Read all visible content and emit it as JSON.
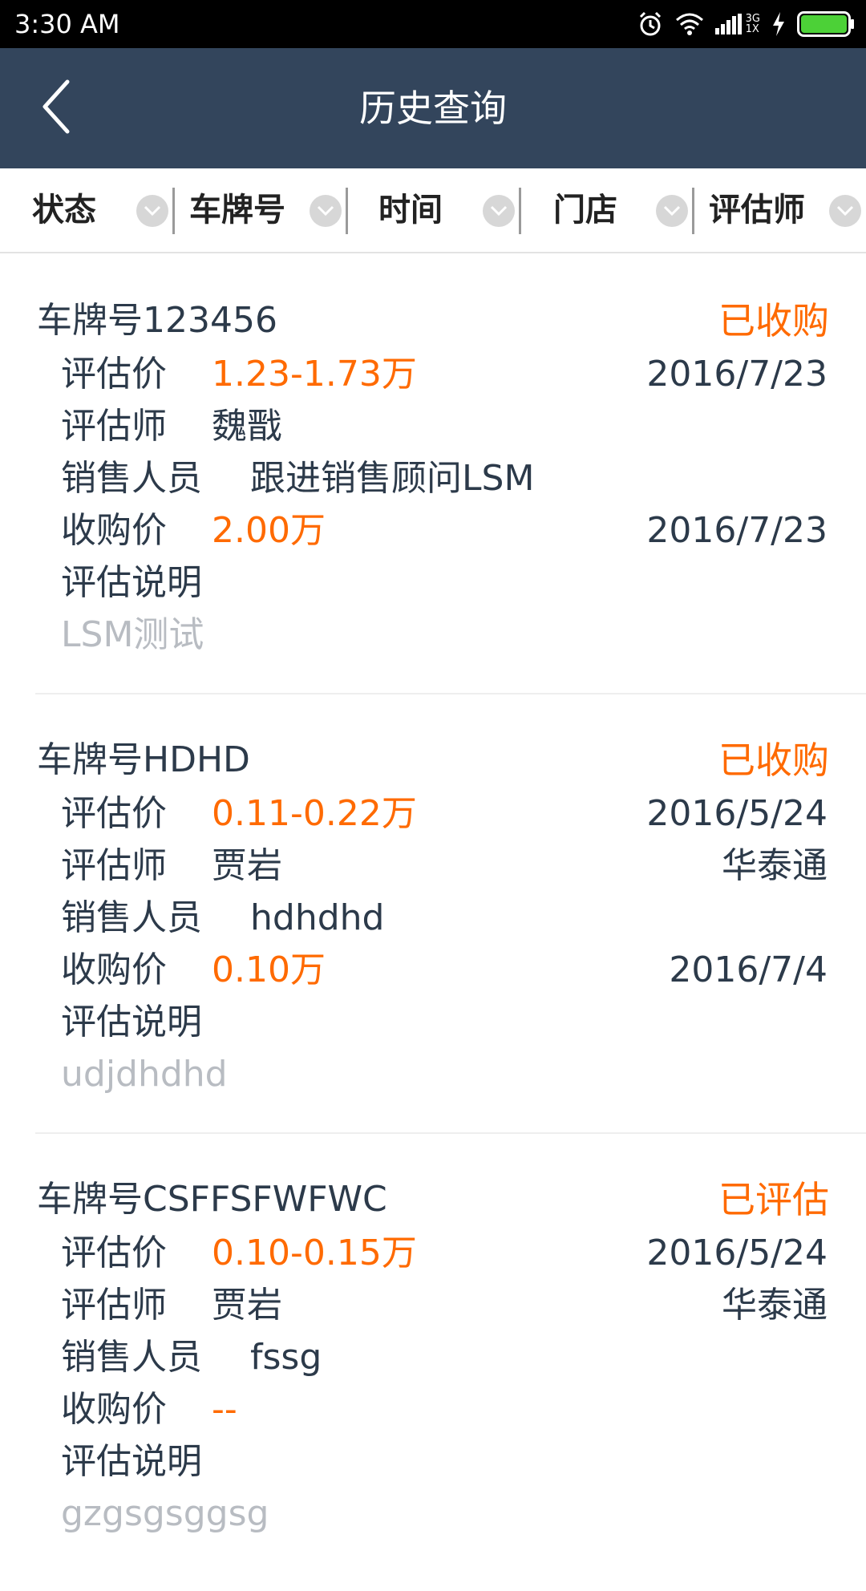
{
  "status_bar": {
    "time": "3:30 AM",
    "icons": [
      "alarm-icon",
      "wifi-icon",
      "signal-icon",
      "charging-icon",
      "battery-icon"
    ],
    "network_label_top": "3G",
    "network_label_bottom": "1X"
  },
  "header": {
    "title": "历史查询",
    "back_icon": "chevron-left-icon"
  },
  "filters": [
    {
      "label": "状态"
    },
    {
      "label": "车牌号"
    },
    {
      "label": "时间"
    },
    {
      "label": "门店"
    },
    {
      "label": "评估师"
    }
  ],
  "labels": {
    "estimate_price": "评估价",
    "appraiser": "评估师",
    "sales_person": "销售人员",
    "purchase_price": "收购价",
    "estimate_note": "评估说明"
  },
  "records": [
    {
      "plate": "车牌号123456",
      "status": "已收购",
      "estimate_price": "1.23-1.73万",
      "estimate_date": "2016/7/23",
      "appraiser": "魏戬",
      "store": "",
      "sales_person": "跟进销售顾问LSM",
      "purchase_price": "2.00万",
      "purchase_date": "2016/7/23",
      "note": "LSM测试"
    },
    {
      "plate": "车牌号HDHD",
      "status": "已收购",
      "estimate_price": "0.11-0.22万",
      "estimate_date": "2016/5/24",
      "appraiser": "贾岩",
      "store": "华泰通",
      "sales_person": "hdhdhd",
      "purchase_price": "0.10万",
      "purchase_date": "2016/7/4",
      "note": "udjdhdhd"
    },
    {
      "plate": "车牌号CSFFSFWFWC",
      "status": "已评估",
      "estimate_price": "0.10-0.15万",
      "estimate_date": "2016/5/24",
      "appraiser": "贾岩",
      "store": "华泰通",
      "sales_person": "fssg",
      "purchase_price": "--",
      "purchase_date": "",
      "note": "gzgsgsggsg"
    }
  ],
  "colors": {
    "header_bg": "#33455c",
    "accent": "#ff6a00",
    "text_primary": "#2c3a4a",
    "text_muted": "#b8bcc2"
  }
}
